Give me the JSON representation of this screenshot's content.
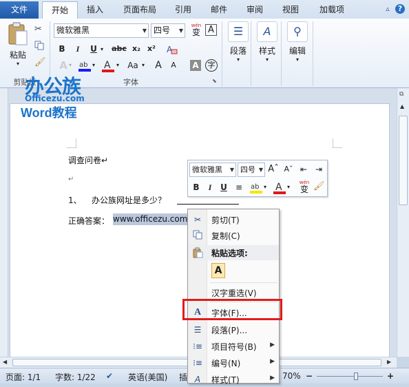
{
  "tabs": {
    "file": "文件",
    "items": [
      {
        "label": "开始",
        "active": true
      },
      {
        "label": "插入",
        "active": false
      },
      {
        "label": "页面布局",
        "active": false
      },
      {
        "label": "引用",
        "active": false
      },
      {
        "label": "邮件",
        "active": false
      },
      {
        "label": "审阅",
        "active": false
      },
      {
        "label": "视图",
        "active": false
      },
      {
        "label": "加载项",
        "active": false
      }
    ]
  },
  "ribbon": {
    "clipboard": {
      "paste_label": "粘贴",
      "group_label": "剪贴板"
    },
    "font": {
      "font_name": "微软雅黑",
      "font_size": "四号",
      "wen_glyph": "wén",
      "wen_char": "变",
      "bold": "B",
      "italic": "I",
      "underline": "U",
      "strike": "abc",
      "subscript": "x₂",
      "superscript": "x²",
      "group_label": "字体",
      "aa_grow": "A",
      "aa_shrink": "A",
      "aa_case": "Aa",
      "char_border": "A",
      "char_shade": "A",
      "enclosed": "字"
    },
    "paragraph": {
      "label": "段落"
    },
    "styles": {
      "label": "样式"
    },
    "editing": {
      "label": "编辑"
    }
  },
  "watermark": {
    "cn": "办公族",
    "en": "Officezu.com",
    "word": "Word教程"
  },
  "document": {
    "line1": "调查问卷↵",
    "line2": "↵",
    "q_num": "1、",
    "question": "办公族网址是多少？",
    "answer_label": "正确答案：",
    "answer_selected": "www.officezu.com"
  },
  "mini_toolbar": {
    "font_name": "微软雅黑",
    "font_size": "四号",
    "bold": "B",
    "italic": "I",
    "underline": "U"
  },
  "context_menu": {
    "items": [
      {
        "label": "剪切(T)",
        "icon": "scissors-icon"
      },
      {
        "label": "复制(C)",
        "icon": "copy-icon"
      },
      {
        "label": "粘贴选项:",
        "icon": "paste-icon",
        "bold": true
      },
      {
        "label": "汉字重选(V)",
        "icon": ""
      },
      {
        "label": "字体(F)...",
        "icon": "font-icon"
      },
      {
        "label": "段落(P)...",
        "icon": "paragraph-icon"
      },
      {
        "label": "项目符号(B)",
        "icon": "bullets-icon",
        "submenu": true
      },
      {
        "label": "编号(N)",
        "icon": "numbering-icon",
        "submenu": true
      },
      {
        "label": "样式(T)",
        "icon": "styles-icon",
        "submenu": true
      }
    ],
    "paste_option_letter": "A"
  },
  "statusbar": {
    "page": "页面: 1/1",
    "words": "字数: 1/22",
    "language": "英语(美国)",
    "insert": "插",
    "zoom": "70%"
  },
  "colors": {
    "accent": "#1f5aa8",
    "highlight_red": "#e21b1b",
    "selection": "#bac7dd"
  }
}
